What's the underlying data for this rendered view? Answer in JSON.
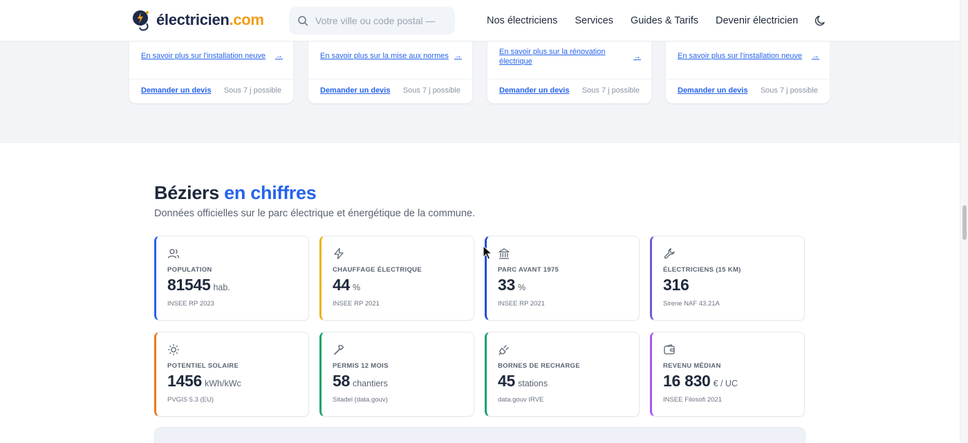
{
  "header": {
    "logo_text": "électricien",
    "logo_tld": ".com",
    "search_placeholder": "Votre ville ou code postal —",
    "nav": [
      "Nos électriciens",
      "Services",
      "Guides & Tarifs",
      "Devenir électricien"
    ]
  },
  "service_cards": [
    {
      "link": "En savoir plus sur l'installation neuve",
      "arrow": "→",
      "quote": "Demander un devis",
      "delay": "Sous 7 j possible"
    },
    {
      "link": "En savoir plus sur la mise aux normes",
      "arrow": "→",
      "quote": "Demander un devis",
      "delay": "Sous 7 j possible"
    },
    {
      "link": "En savoir plus sur la rénovation électrique",
      "arrow": "→",
      "quote": "Demander un devis",
      "delay": "Sous 7 j possible"
    },
    {
      "link": "En savoir plus sur l'installation neuve",
      "arrow": "→",
      "quote": "Demander un devis",
      "delay": "Sous 7 j possible"
    }
  ],
  "stats_section": {
    "title_main": "Béziers",
    "title_accent": "en chiffres",
    "subtitle": "Données officielles sur le parc électrique et énergétique de la commune."
  },
  "stats": [
    {
      "icon": "users-icon",
      "color": "#2563eb",
      "label": "POPULATION",
      "value": "81545",
      "unit": "hab.",
      "source": "INSEE RP 2023"
    },
    {
      "icon": "bolt-icon",
      "color": "#eab308",
      "label": "CHAUFFAGE ÉLECTRIQUE",
      "value": "44",
      "unit": "%",
      "source": "INSEE RP 2021"
    },
    {
      "icon": "bank-icon",
      "color": "#1d4ed8",
      "label": "PARC AVANT 1975",
      "value": "33",
      "unit": "%",
      "source": "INSEE RP 2021"
    },
    {
      "icon": "wrench-icon",
      "color": "#6d5bd0",
      "label": "ÉLECTRICIENS (15 KM)",
      "value": "316",
      "unit": "",
      "source": "Sirene NAF 43.21A"
    },
    {
      "icon": "sun-icon",
      "color": "#ea7a1a",
      "label": "POTENTIEL SOLAIRE",
      "value": "1456",
      "unit": "kWh/kWc",
      "source": "PVGIS 5.3 (EU)"
    },
    {
      "icon": "hammer-icon",
      "color": "#16a36a",
      "label": "PERMIS 12 MOIS",
      "value": "58",
      "unit": "chantiers",
      "source": "Sitadel (data.gouv)"
    },
    {
      "icon": "plug-icon",
      "color": "#16a36a",
      "label": "BORNES DE RECHARGE",
      "value": "45",
      "unit": "stations",
      "source": "data.gouv IRVE"
    },
    {
      "icon": "wallet-icon",
      "color": "#a855f7",
      "label": "REVENU MÉDIAN",
      "value": "16 830",
      "unit": "€ / UC",
      "source": "INSEE Filosofi 2021"
    }
  ]
}
